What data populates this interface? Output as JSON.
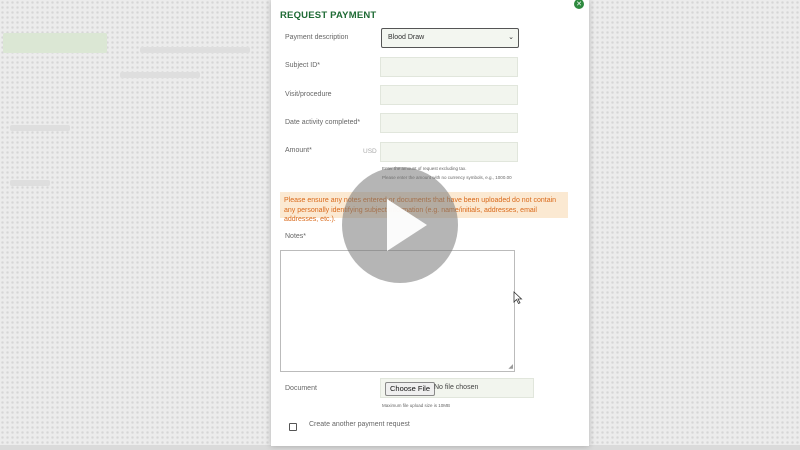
{
  "modal": {
    "title": "REQUEST PAYMENT",
    "close_icon": "close-icon"
  },
  "form": {
    "payment_description_label": "Payment description",
    "payment_description_value": "Blood Draw",
    "subject_id_label": "Subject ID*",
    "subject_id_value": "",
    "visit_label": "Visit/procedure",
    "visit_value": "",
    "date_label": "Date activity completed*",
    "date_value": "",
    "amount_label": "Amount*",
    "amount_unit": "USD",
    "amount_value": "",
    "amount_hint_1": "Enter the amount of request excluding tax.",
    "amount_hint_2": "Please enter the amount with no currency symbols, e.g., 1000.00",
    "warning": "Please ensure any notes entered or documents that have been uploaded do not contain any personally identifying subject information (e.g. name/initials, addresses, email addresses, etc.).",
    "notes_label": "Notes*",
    "notes_value": "",
    "document_label": "Document",
    "choose_file_label": "Choose File",
    "file_status": "No file chosen",
    "file_hint": "Maximum file upload size is 10MB",
    "create_another_label": "Create another payment request",
    "create_another_checked": false
  },
  "colors": {
    "accent": "#1f6b35",
    "warning_text": "#d9691a",
    "warning_bg": "#fbe9d2",
    "field_bg": "#f2f5ee"
  }
}
